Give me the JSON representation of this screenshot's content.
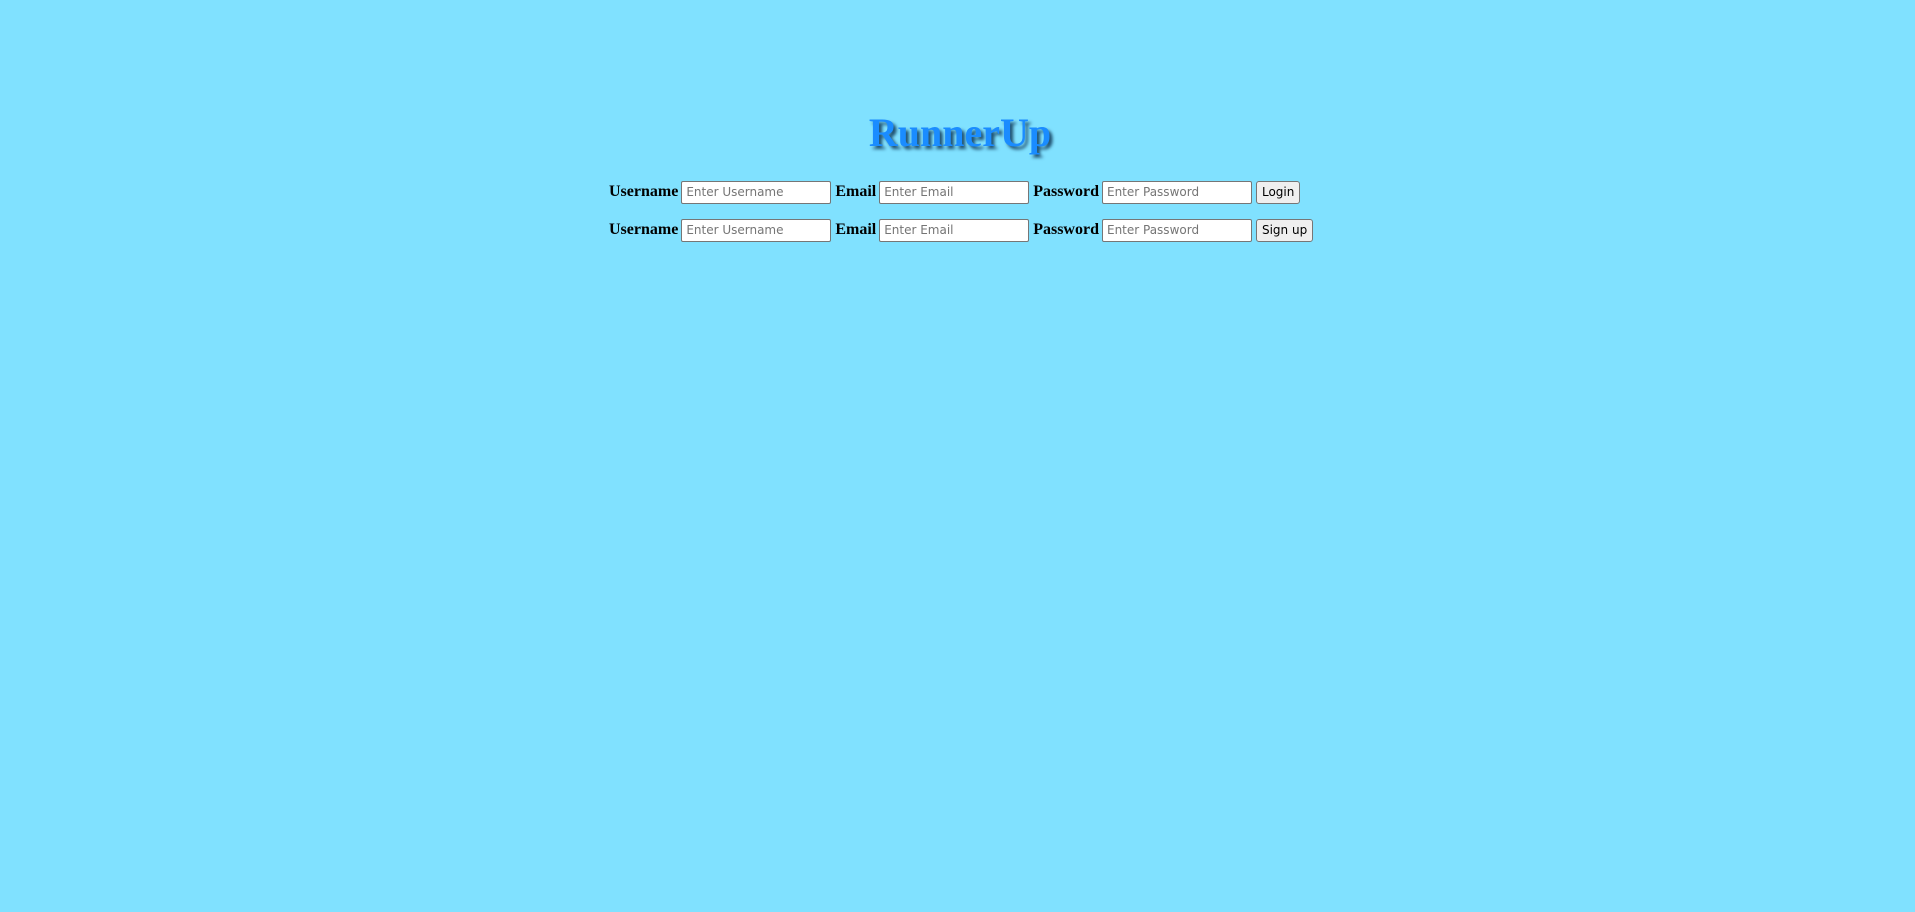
{
  "app": {
    "title": "RunnerUp"
  },
  "login_form": {
    "username_label": "Username",
    "username_placeholder": "Enter Username",
    "email_label": "Email",
    "email_placeholder": "Enter Email",
    "password_label": "Password",
    "password_placeholder": "Enter Password",
    "submit_label": "Login"
  },
  "signup_form": {
    "username_label": "Username",
    "username_placeholder": "Enter Username",
    "email_label": "Email",
    "email_placeholder": "Enter Email",
    "password_label": "Password",
    "password_placeholder": "Enter Password",
    "submit_label": "Sign up"
  },
  "colors": {
    "background": "#80e1ff",
    "title": "#1a8cff"
  }
}
